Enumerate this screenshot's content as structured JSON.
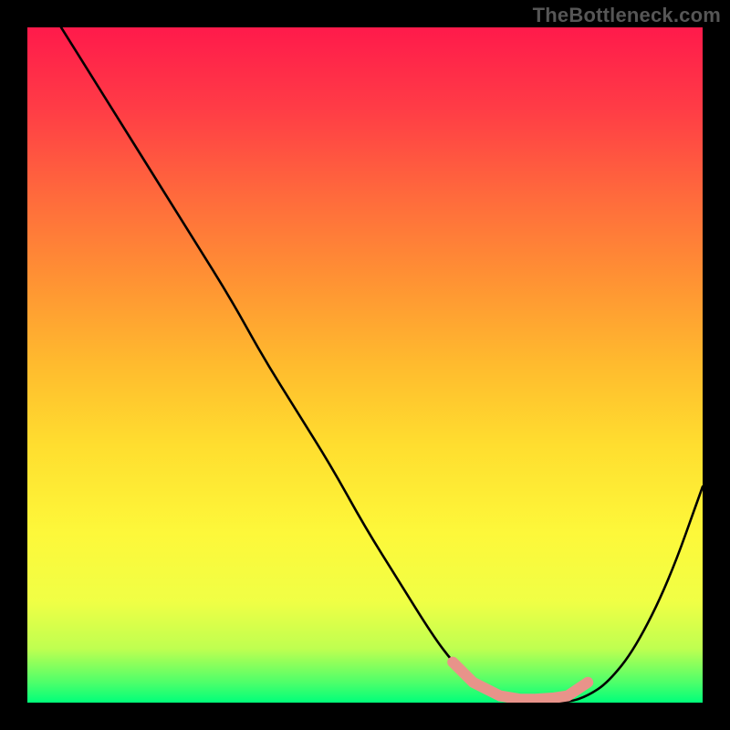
{
  "watermark": "TheBottleneck.com",
  "chart_data": {
    "type": "line",
    "title": "",
    "xlabel": "",
    "ylabel": "",
    "xlim": [
      0,
      100
    ],
    "ylim": [
      0,
      100
    ],
    "series": [
      {
        "name": "main-curve",
        "color": "#000000",
        "x": [
          5,
          10,
          15,
          20,
          25,
          30,
          35,
          40,
          45,
          50,
          55,
          60,
          63,
          66,
          70,
          75,
          80,
          83,
          86,
          90,
          95,
          100
        ],
        "y": [
          100,
          92,
          84,
          76,
          68,
          60,
          51,
          43,
          35,
          26,
          18,
          10,
          6,
          3,
          1,
          0,
          0,
          1,
          3,
          8,
          18,
          32
        ]
      },
      {
        "name": "plateau-marker",
        "color": "#e8938a",
        "x": [
          63,
          66,
          70,
          73,
          75,
          78,
          80,
          83
        ],
        "y": [
          6,
          3,
          1,
          0.5,
          0.5,
          0.7,
          1,
          3
        ]
      }
    ],
    "gradient_stops": [
      {
        "pos": 0,
        "color": "#ff1a4b"
      },
      {
        "pos": 25,
        "color": "#ff6a3c"
      },
      {
        "pos": 50,
        "color": "#ffbb2e"
      },
      {
        "pos": 75,
        "color": "#fdf83a"
      },
      {
        "pos": 92,
        "color": "#bfff50"
      },
      {
        "pos": 100,
        "color": "#00ff7a"
      }
    ]
  }
}
